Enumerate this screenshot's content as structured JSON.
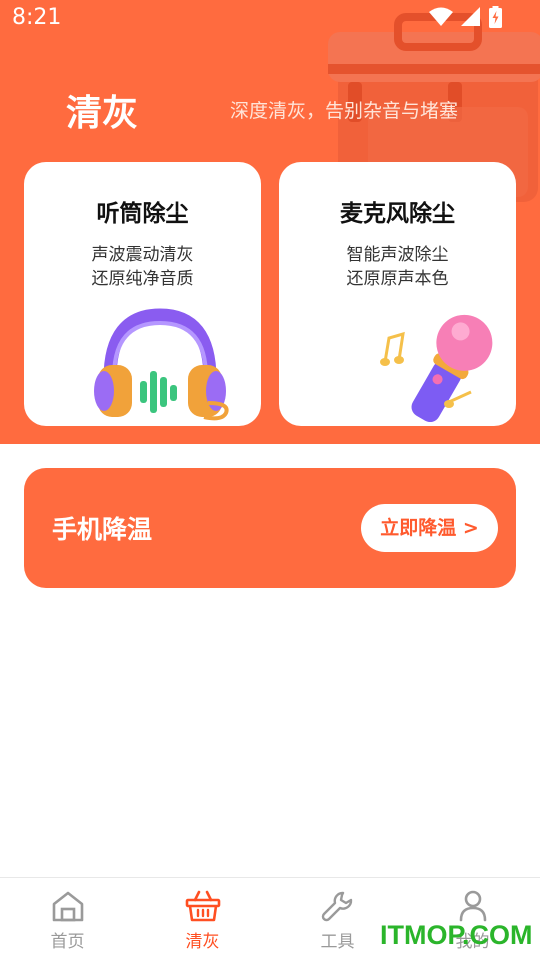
{
  "status_bar": {
    "time": "8:21"
  },
  "header": {
    "title": "清灰",
    "subtitle": "深度清灰，告别杂音与堵塞"
  },
  "cards": [
    {
      "title": "听筒除尘",
      "line1": "声波震动清灰",
      "line2": "还原纯净音质",
      "illustration": "headphones-icon"
    },
    {
      "title": "麦克风除尘",
      "line1": "智能声波除尘",
      "line2": "还原原声本色",
      "illustration": "microphone-icon"
    }
  ],
  "cooling": {
    "title": "手机降温",
    "button_label": "立即降温 >"
  },
  "tabs": [
    {
      "label": "首页",
      "icon": "home-icon",
      "active": false
    },
    {
      "label": "清灰",
      "icon": "basket-icon",
      "active": true
    },
    {
      "label": "工具",
      "icon": "wrench-icon",
      "active": false
    },
    {
      "label": "我的",
      "icon": "user-icon",
      "active": false
    }
  ],
  "watermark": "ITMOP.COM",
  "colors": {
    "accent": "#ff6b3f",
    "active_tab": "#ff4f22",
    "inactive_tab": "#9a9a9a"
  }
}
